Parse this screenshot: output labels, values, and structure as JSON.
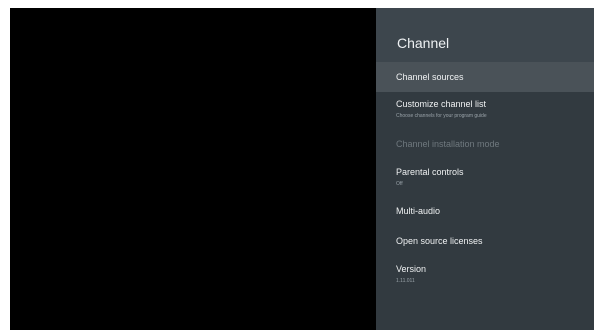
{
  "panel": {
    "title": "Channel",
    "items": [
      {
        "label": "Channel sources"
      },
      {
        "label": "Customize channel list",
        "sub": "Choose channels for your program guide"
      },
      {
        "label": "Channel installation mode"
      },
      {
        "label": "Parental controls",
        "sub": "Off"
      },
      {
        "label": "Multi-audio"
      },
      {
        "label": "Open source licenses"
      },
      {
        "label": "Version",
        "sub": "1.11.011"
      }
    ]
  }
}
